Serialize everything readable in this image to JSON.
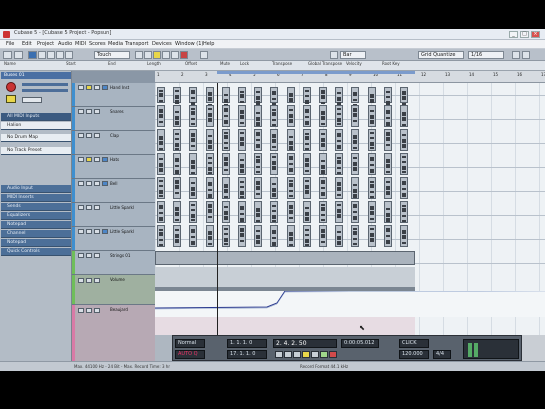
{
  "window": {
    "title": "Cubase 5 - [Cubase 5 Project - Popsun]",
    "controls": [
      "_",
      "□",
      "×"
    ]
  },
  "menu": [
    "File",
    "Edit",
    "Project",
    "Audio",
    "MIDI",
    "Scores",
    "Media",
    "Transport",
    "Devices",
    "Window (1)",
    "Help"
  ],
  "toolbar": {
    "snap_value": "Touch",
    "quantize_value": "Grid Quantize",
    "grid_value": "1/16",
    "bar_value": "Bar"
  },
  "info_line": [
    "Name",
    "Start",
    "End",
    "Length",
    "Offset",
    "Mute",
    "Lock",
    "Transpose",
    "Global Transpose",
    "Velocity",
    "Root Key"
  ],
  "inspector": {
    "track_name": "Buses 01",
    "sections": [
      "Audio Input",
      "MIDI Inserts",
      "Sends",
      "Equalizers",
      "Notepad",
      "Channel",
      "Notepad",
      "Quick Controls"
    ],
    "input_label": "All MIDI Inputs",
    "output_label": "Halion",
    "no_drum_map": "No Drum Map",
    "no_bank": "No Track Preset"
  },
  "tracks": [
    {
      "name": "Hand Inst",
      "color": "#3f8fcf"
    },
    {
      "name": "Snares",
      "color": "#3f8fcf"
    },
    {
      "name": "Clap",
      "color": "#3f8fcf"
    },
    {
      "name": "Hats",
      "color": "#3f8fcf"
    },
    {
      "name": "Bell",
      "color": "#3f8fcf"
    },
    {
      "name": "Little Sparkl",
      "color": "#3f8fcf"
    },
    {
      "name": "Little Sparkl",
      "color": "#3f8fcf"
    },
    {
      "name": "Strings 01",
      "color": "#6fbe5a"
    },
    {
      "name": "Volume",
      "color": "#6fbe5a"
    },
    {
      "name": "Beaujard",
      "color": "#d97aa6"
    }
  ],
  "ruler": [
    "1",
    "2",
    "3",
    "4",
    "5",
    "6",
    "7",
    "8",
    "9",
    "10",
    "11",
    "12",
    "13",
    "14",
    "15",
    "16",
    "17"
  ],
  "transport": {
    "position": "2. 4. 2. 50",
    "time": "0:00:05.012",
    "tempo": "120.000",
    "signature": "4/4",
    "left_locator": "1. 1. 1. 0",
    "right_locator": "17. 1. 1. 0",
    "mode_label": "Normal",
    "auto_label": "AUTO Q",
    "click_label": "CLICK"
  },
  "status": {
    "left": "Max. 44100 Hz - 24 Bit - Max. Record Time: 3 hr",
    "right": "Record Format 44.1 kHz"
  }
}
